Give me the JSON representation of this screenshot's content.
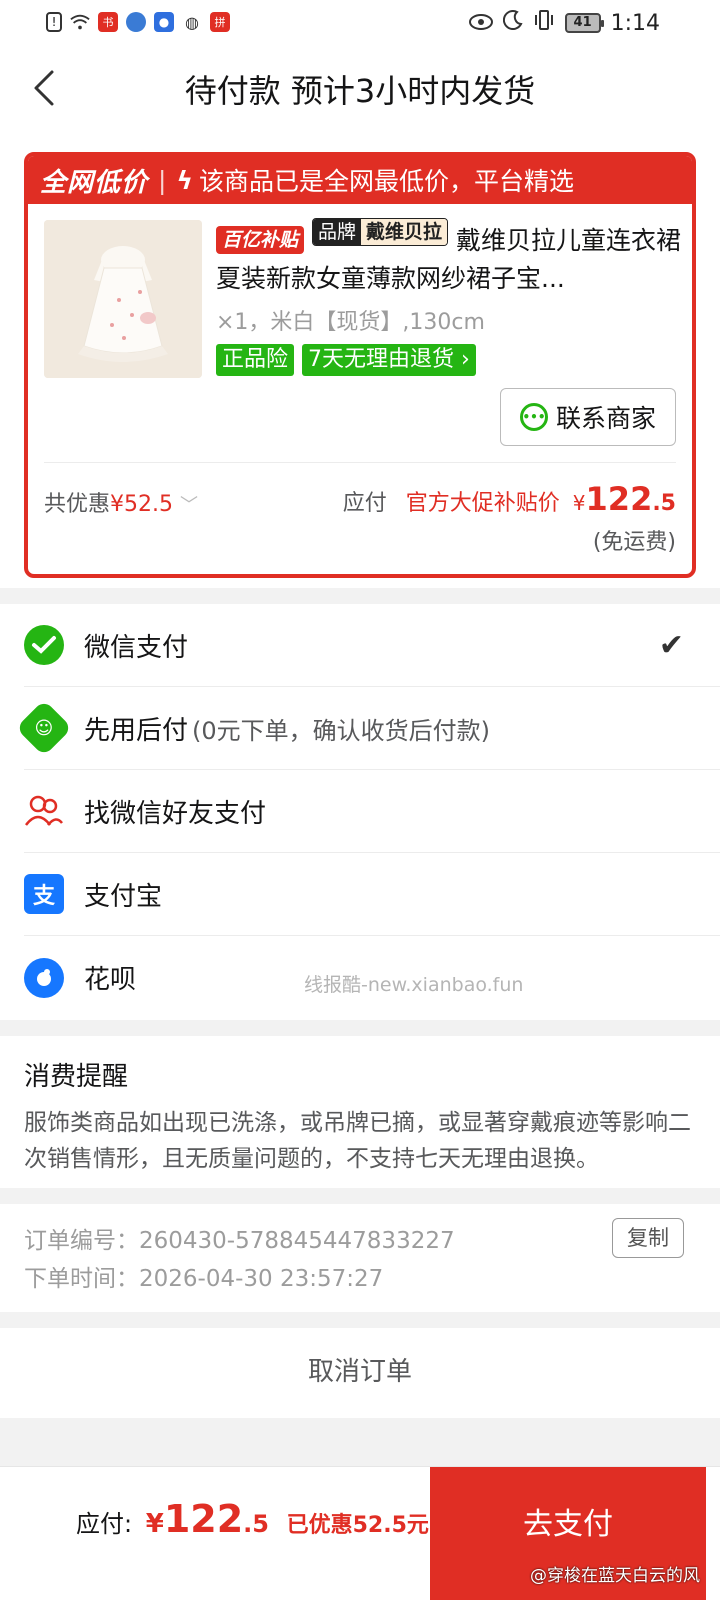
{
  "status_bar": {
    "time": "1:14",
    "battery": "41"
  },
  "nav": {
    "title": "待付款 预计3小时内发货"
  },
  "card": {
    "banner_tag": "全网低价",
    "banner_text": "该商品已是全网最低价，平台精选",
    "tag_subsidy": "百亿补贴",
    "tag_brand_key": "品牌",
    "tag_brand_value": "戴维贝拉",
    "product_title": "戴维贝拉儿童连衣裙夏装新款女童薄款网纱裙子宝...",
    "spec": "×1，米白【现货】,130cm",
    "badges": [
      "正品险",
      "7天无理由退货"
    ],
    "contact_label": "联系商家",
    "discount_label": "共优惠",
    "discount_value": "¥52.5",
    "pay_label": "应付",
    "promo_label": "官方大促补贴价",
    "currency": "¥",
    "price_int": "122",
    "price_dec": ".5",
    "shipping": "(免运费)"
  },
  "methods": [
    {
      "label": "微信支付",
      "icon": "wechat-pay-icon",
      "color": "#25b513",
      "selected": true
    },
    {
      "label": "先用后付",
      "sub": "(0元下单，确认收货后付款)",
      "icon": "pay-later-icon",
      "color": "#25b513"
    },
    {
      "label": "找微信好友支付",
      "icon": "friend-pay-icon",
      "color": "#e02e24"
    },
    {
      "label": "支付宝",
      "icon": "alipay-icon",
      "color": "#1677ff"
    },
    {
      "label": "花呗",
      "icon": "huabei-icon",
      "color": "#1677ff"
    }
  ],
  "watermark": "线报酷-new.xianbao.fun",
  "notice": {
    "title": "消费提醒",
    "body": "服饰类商品如出现已洗涤，或吊牌已摘，或显著穿戴痕迹等影响二次销售情形，且无质量问题的，不支持七天无理由退换。"
  },
  "order": {
    "number_label": "订单编号：",
    "number": "260430-578845447833227",
    "time_label": "下单时间：",
    "time": "2026-04-30 23:57:27",
    "copy_label": "复制"
  },
  "cancel_label": "取消订单",
  "bottom": {
    "pay_label": "应付:",
    "currency": "¥",
    "price_int": "122",
    "price_dec": ".5",
    "saved": "已优惠52.5元",
    "button": "去支付",
    "credit": "@穿梭在蓝天白云的风"
  }
}
